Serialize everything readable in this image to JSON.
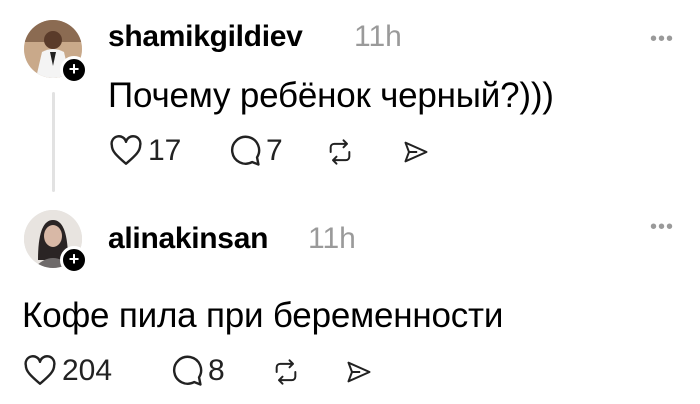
{
  "comments": [
    {
      "username": "shamikgildiev",
      "time": "11h",
      "text": "Почему ребёнок черный?)))",
      "likes": "17",
      "replies": "7",
      "icons": [
        "heart-icon",
        "comment-icon",
        "repost-icon",
        "share-icon",
        "more-icon",
        "follow-plus-icon"
      ]
    },
    {
      "username": "alinakinsan",
      "time": "11h",
      "text": "Кофе пила при беременности",
      "likes": "204",
      "replies": "8",
      "icons": [
        "heart-icon",
        "comment-icon",
        "repost-icon",
        "share-icon",
        "more-icon",
        "follow-plus-icon"
      ]
    }
  ],
  "more_label": "•••",
  "plus_label": "+"
}
